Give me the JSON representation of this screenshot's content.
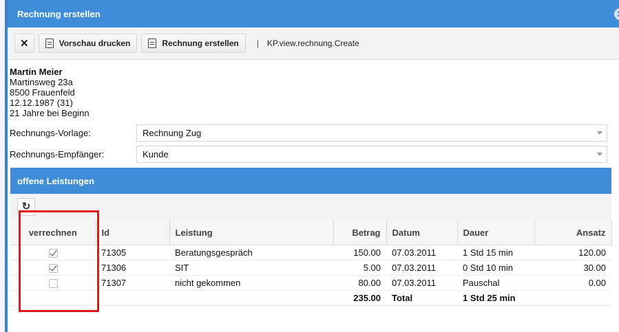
{
  "window": {
    "title": "Rechnung erstellen"
  },
  "toolbar": {
    "preview_label": "Vorschau drucken",
    "create_label": "Rechnung erstellen",
    "separator": "|",
    "view_name": "KP.view.rechnung.Create"
  },
  "person": {
    "name": "Martin Meier",
    "street": "Martinsweg 23a",
    "city": "8500 Frauenfeld",
    "birth": "12.12.1987 (31)",
    "age_note": "21 Jahre bei Beginn"
  },
  "form": {
    "vorlage_label": "Rechnungs-Vorlage:",
    "vorlage_value": "Rechnung Zug",
    "empfaenger_label": "Rechnungs-Empfänger:",
    "empfaenger_value": "Kunde"
  },
  "grid": {
    "title": "offene Leistungen",
    "columns": {
      "verrechnen": "verrechnen",
      "id": "Id",
      "leistung": "Leistung",
      "betrag": "Betrag",
      "datum": "Datum",
      "dauer": "Dauer",
      "ansatz": "Ansatz"
    },
    "rows": [
      {
        "checked": true,
        "id": "71305",
        "leistung": "Beratungsgespräch",
        "betrag": "150.00",
        "datum": "07.03.2011",
        "dauer": "1 Std 15 min",
        "ansatz": "120.00"
      },
      {
        "checked": true,
        "id": "71306",
        "leistung": "SIT",
        "betrag": "5.00",
        "datum": "07.03.2011",
        "dauer": "0 Std 10 min",
        "ansatz": "30.00"
      },
      {
        "checked": false,
        "id": "71307",
        "leistung": "nicht gekommen",
        "betrag": "80.00",
        "datum": "07.03.2011",
        "dauer": "Pauschal",
        "ansatz": "0.00"
      }
    ],
    "total": {
      "betrag": "235.00",
      "label": "Total",
      "dauer": "1 Std 25 min"
    }
  },
  "icons": {
    "close_window": "close-circle-icon",
    "cancel": "x-icon",
    "document": "document-icon",
    "refresh": "refresh-icon"
  },
  "colors": {
    "header_blue": "#3f8dd8",
    "highlight_red": "#e0161d"
  }
}
